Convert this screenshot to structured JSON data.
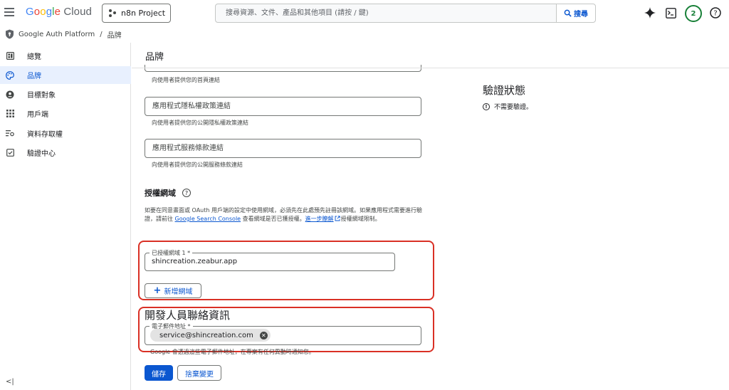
{
  "topbar": {
    "logo_google": "Google",
    "logo_cloud": "Cloud",
    "project": "n8n Project",
    "search_placeholder": "搜尋資源、文件、產品和其他項目 (請按 / 鍵)",
    "search_button": "搜尋",
    "notification_count": "2"
  },
  "breadcrumb": {
    "platform": "Google Auth Platform",
    "separator": "/",
    "current": "品牌"
  },
  "sidebar": {
    "items": [
      {
        "label": "總覽",
        "icon": "dashboard-icon"
      },
      {
        "label": "品牌",
        "icon": "palette-icon",
        "active": true
      },
      {
        "label": "目標對象",
        "icon": "audience-icon"
      },
      {
        "label": "用戶端",
        "icon": "clients-icon"
      },
      {
        "label": "資料存取權",
        "icon": "data-access-icon"
      },
      {
        "label": "驗證中心",
        "icon": "verification-icon"
      }
    ],
    "collapse": "<|"
  },
  "main": {
    "title": "品牌",
    "homepage_helper": "向使用者提供您的首頁連結",
    "privacy_field": "應用程式隱私權政策連結",
    "privacy_helper": "向使用者提供您的公開隱私權政策連結",
    "tos_field": "應用程式服務條款連結",
    "tos_helper": "向使用者提供您的公開服務條款連結",
    "authorized_domains": {
      "heading": "授權網域",
      "help": "?",
      "desc_1": "如要在同意畫面或 OAuth 用戶端的設定中使用網域，必須先在此處預先註冊該網域。如果應用程式需要進行驗證，請前往 ",
      "desc_link": "Google Search Console",
      "desc_2": " 查看網域是否已獲授權。",
      "desc_learn_more": "進一步瞭解",
      "desc_3": "授權網域限制。",
      "field_label": "已授權網域 1 *",
      "field_value": "shincreation.zeabur.app",
      "add_button": "新增網域"
    },
    "developer_contact": {
      "heading": "開發人員聯絡資訊",
      "email_label": "電子郵件地址 *",
      "email_chip": "service@shincreation.com",
      "notice": "Google 會透過這些電子郵件地址，在專案有任何異動時通知您。"
    },
    "save_button": "儲存",
    "discard_button": "捨棄變更"
  },
  "verification": {
    "title": "驗證狀態",
    "status": "不需要驗證。"
  },
  "colors": {
    "accent": "#0b57d0",
    "highlight_box": "#d93025",
    "active_nav_bg": "#e8f0fe"
  }
}
